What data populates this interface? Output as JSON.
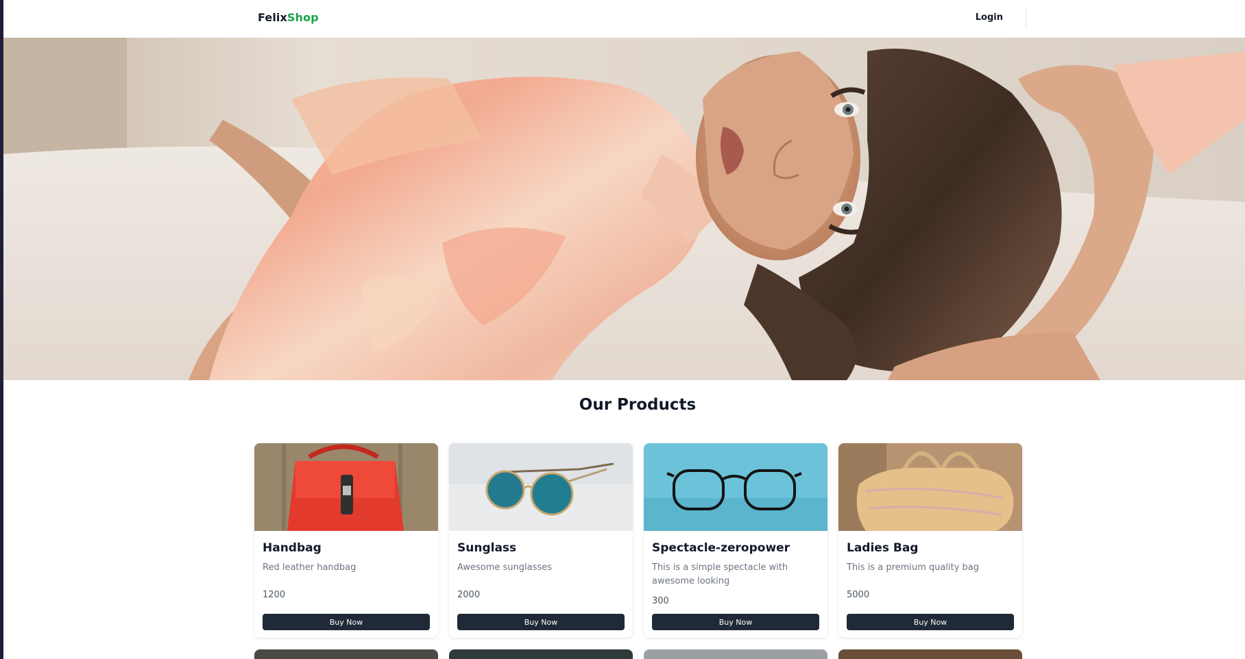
{
  "navbar": {
    "brand_part1": "Felix",
    "brand_part2": "Shop",
    "login_label": "Login",
    "brand_accent_color": "#16a34a"
  },
  "hero": {
    "image": "woman lying on bed in pastel tie-dye shirt"
  },
  "products_section": {
    "title": "Our Products",
    "cards": [
      {
        "image": "red-handbag-photo",
        "name": "Handbag",
        "description": "Red leather handbag",
        "price": "1200",
        "button_label": "Buy Now"
      },
      {
        "image": "round-sunglasses-photo",
        "name": "Sunglass",
        "description": "Awesome sunglasses",
        "price": "2000",
        "button_label": "Buy Now"
      },
      {
        "image": "black-spectacles-photo",
        "name": "Spectacle-zeropower",
        "description": "This is a simple spectacle with awesome looking",
        "price": "300",
        "button_label": "Buy Now"
      },
      {
        "image": "tan-ladies-bag-photo",
        "name": "Ladies Bag",
        "description": "This is a premium quality bag",
        "price": "5000",
        "button_label": "Buy Now"
      }
    ]
  },
  "colors": {
    "button_bg": "#1f2937",
    "text_primary": "#111827",
    "text_muted": "#6b7280"
  }
}
